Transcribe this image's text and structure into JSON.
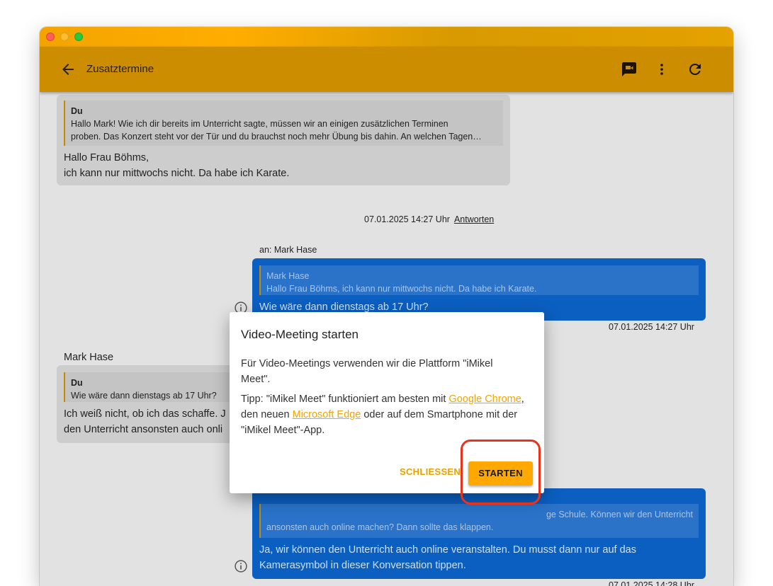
{
  "window": {
    "title": ""
  },
  "appbar": {
    "title": "Zusatztermine",
    "icons": [
      "back-arrow-icon",
      "video-chat-icon",
      "more-vert-icon",
      "refresh-icon"
    ]
  },
  "messages": [
    {
      "type": "incoming",
      "quote_name": "Du",
      "quote_text_1": "Hallo Mark! Wie ich dir bereits im Unterricht sagte, müssen wir an einigen zusätzlichen Terminen",
      "quote_text_2": "proben. Das Konzert steht vor der Tür und du brauchst noch mehr Übung bis dahin. An welchen Tagen…",
      "text_1": "Hallo Frau Böhms,",
      "text_2": "ich kann nur mittwochs nicht. Da habe ich Karate.",
      "timestamp": "07.01.2025 14:27 Uhr",
      "reply_label": "Antworten"
    },
    {
      "type": "outgoing",
      "recipient": "an: Mark Hase",
      "quote_name": "Mark Hase",
      "quote_text": "Hallo Frau Böhms, ich kann nur mittwochs nicht. Da habe ich Karate.",
      "text": "Wie wäre dann dienstags ab 17 Uhr?",
      "timestamp": "07.01.2025 14:27 Uhr"
    },
    {
      "type": "incoming",
      "sender": "Mark Hase",
      "quote_name": "Du",
      "quote_text": "Wie wäre dann dienstags ab 17 Uhr?",
      "text_1": "Ich weiß nicht, ob ich das schaffe. J",
      "text_2": "den Unterricht ansonsten auch onli"
    },
    {
      "type": "outgoing",
      "quote_text_1": "ge Schule. Können wir den Unterricht",
      "quote_text_2": "ansonsten auch online machen? Dann sollte das klappen.",
      "text_1": "Ja, wir können den Unterricht auch online veranstalten. Du musst dann nur auf das",
      "text_2": "Kamerasymbol in dieser Konversation tippen.",
      "timestamp": "07.01.2025 14:28 Uhr"
    }
  ],
  "dialog": {
    "title": "Video-Meeting starten",
    "paragraph_1": "Für Video-Meetings verwenden wir die Plattform \"iMikel Meet\".",
    "tip_prefix": "Tipp: \"iMikel Meet\" funktioniert am besten mit ",
    "link_chrome": "Google Chrome",
    "tip_middle": ", den neuen ",
    "link_edge": "Microsoft Edge",
    "tip_suffix": " oder auf dem Smartphone mit der \"iMikel Meet\"-App.",
    "close_label": "SCHLIESSEN",
    "start_label": "STARTEN"
  },
  "colors": {
    "appbar": "#cc8d00",
    "accent": "#ffa800",
    "outgoing_bubble": "#0b5fc1",
    "highlight": "#e8321b"
  }
}
